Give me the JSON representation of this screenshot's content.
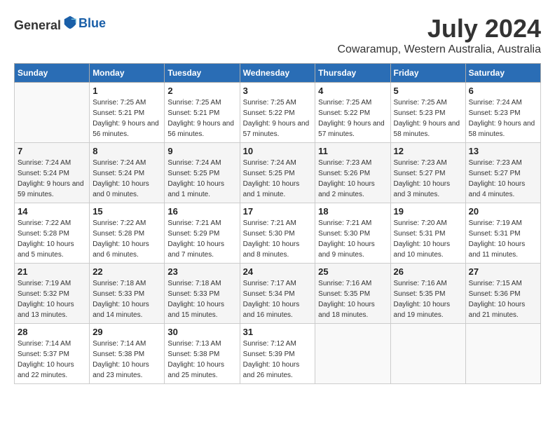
{
  "header": {
    "logo_general": "General",
    "logo_blue": "Blue",
    "month_title": "July 2024",
    "location": "Cowaramup, Western Australia, Australia"
  },
  "calendar": {
    "days_of_week": [
      "Sunday",
      "Monday",
      "Tuesday",
      "Wednesday",
      "Thursday",
      "Friday",
      "Saturday"
    ],
    "weeks": [
      [
        {
          "day": "",
          "sunrise": "",
          "sunset": "",
          "daylight": ""
        },
        {
          "day": "1",
          "sunrise": "Sunrise: 7:25 AM",
          "sunset": "Sunset: 5:21 PM",
          "daylight": "Daylight: 9 hours and 56 minutes."
        },
        {
          "day": "2",
          "sunrise": "Sunrise: 7:25 AM",
          "sunset": "Sunset: 5:21 PM",
          "daylight": "Daylight: 9 hours and 56 minutes."
        },
        {
          "day": "3",
          "sunrise": "Sunrise: 7:25 AM",
          "sunset": "Sunset: 5:22 PM",
          "daylight": "Daylight: 9 hours and 57 minutes."
        },
        {
          "day": "4",
          "sunrise": "Sunrise: 7:25 AM",
          "sunset": "Sunset: 5:22 PM",
          "daylight": "Daylight: 9 hours and 57 minutes."
        },
        {
          "day": "5",
          "sunrise": "Sunrise: 7:25 AM",
          "sunset": "Sunset: 5:23 PM",
          "daylight": "Daylight: 9 hours and 58 minutes."
        },
        {
          "day": "6",
          "sunrise": "Sunrise: 7:24 AM",
          "sunset": "Sunset: 5:23 PM",
          "daylight": "Daylight: 9 hours and 58 minutes."
        }
      ],
      [
        {
          "day": "7",
          "sunrise": "Sunrise: 7:24 AM",
          "sunset": "Sunset: 5:24 PM",
          "daylight": "Daylight: 9 hours and 59 minutes."
        },
        {
          "day": "8",
          "sunrise": "Sunrise: 7:24 AM",
          "sunset": "Sunset: 5:24 PM",
          "daylight": "Daylight: 10 hours and 0 minutes."
        },
        {
          "day": "9",
          "sunrise": "Sunrise: 7:24 AM",
          "sunset": "Sunset: 5:25 PM",
          "daylight": "Daylight: 10 hours and 1 minute."
        },
        {
          "day": "10",
          "sunrise": "Sunrise: 7:24 AM",
          "sunset": "Sunset: 5:25 PM",
          "daylight": "Daylight: 10 hours and 1 minute."
        },
        {
          "day": "11",
          "sunrise": "Sunrise: 7:23 AM",
          "sunset": "Sunset: 5:26 PM",
          "daylight": "Daylight: 10 hours and 2 minutes."
        },
        {
          "day": "12",
          "sunrise": "Sunrise: 7:23 AM",
          "sunset": "Sunset: 5:27 PM",
          "daylight": "Daylight: 10 hours and 3 minutes."
        },
        {
          "day": "13",
          "sunrise": "Sunrise: 7:23 AM",
          "sunset": "Sunset: 5:27 PM",
          "daylight": "Daylight: 10 hours and 4 minutes."
        }
      ],
      [
        {
          "day": "14",
          "sunrise": "Sunrise: 7:22 AM",
          "sunset": "Sunset: 5:28 PM",
          "daylight": "Daylight: 10 hours and 5 minutes."
        },
        {
          "day": "15",
          "sunrise": "Sunrise: 7:22 AM",
          "sunset": "Sunset: 5:28 PM",
          "daylight": "Daylight: 10 hours and 6 minutes."
        },
        {
          "day": "16",
          "sunrise": "Sunrise: 7:21 AM",
          "sunset": "Sunset: 5:29 PM",
          "daylight": "Daylight: 10 hours and 7 minutes."
        },
        {
          "day": "17",
          "sunrise": "Sunrise: 7:21 AM",
          "sunset": "Sunset: 5:30 PM",
          "daylight": "Daylight: 10 hours and 8 minutes."
        },
        {
          "day": "18",
          "sunrise": "Sunrise: 7:21 AM",
          "sunset": "Sunset: 5:30 PM",
          "daylight": "Daylight: 10 hours and 9 minutes."
        },
        {
          "day": "19",
          "sunrise": "Sunrise: 7:20 AM",
          "sunset": "Sunset: 5:31 PM",
          "daylight": "Daylight: 10 hours and 10 minutes."
        },
        {
          "day": "20",
          "sunrise": "Sunrise: 7:19 AM",
          "sunset": "Sunset: 5:31 PM",
          "daylight": "Daylight: 10 hours and 11 minutes."
        }
      ],
      [
        {
          "day": "21",
          "sunrise": "Sunrise: 7:19 AM",
          "sunset": "Sunset: 5:32 PM",
          "daylight": "Daylight: 10 hours and 13 minutes."
        },
        {
          "day": "22",
          "sunrise": "Sunrise: 7:18 AM",
          "sunset": "Sunset: 5:33 PM",
          "daylight": "Daylight: 10 hours and 14 minutes."
        },
        {
          "day": "23",
          "sunrise": "Sunrise: 7:18 AM",
          "sunset": "Sunset: 5:33 PM",
          "daylight": "Daylight: 10 hours and 15 minutes."
        },
        {
          "day": "24",
          "sunrise": "Sunrise: 7:17 AM",
          "sunset": "Sunset: 5:34 PM",
          "daylight": "Daylight: 10 hours and 16 minutes."
        },
        {
          "day": "25",
          "sunrise": "Sunrise: 7:16 AM",
          "sunset": "Sunset: 5:35 PM",
          "daylight": "Daylight: 10 hours and 18 minutes."
        },
        {
          "day": "26",
          "sunrise": "Sunrise: 7:16 AM",
          "sunset": "Sunset: 5:35 PM",
          "daylight": "Daylight: 10 hours and 19 minutes."
        },
        {
          "day": "27",
          "sunrise": "Sunrise: 7:15 AM",
          "sunset": "Sunset: 5:36 PM",
          "daylight": "Daylight: 10 hours and 21 minutes."
        }
      ],
      [
        {
          "day": "28",
          "sunrise": "Sunrise: 7:14 AM",
          "sunset": "Sunset: 5:37 PM",
          "daylight": "Daylight: 10 hours and 22 minutes."
        },
        {
          "day": "29",
          "sunrise": "Sunrise: 7:14 AM",
          "sunset": "Sunset: 5:38 PM",
          "daylight": "Daylight: 10 hours and 23 minutes."
        },
        {
          "day": "30",
          "sunrise": "Sunrise: 7:13 AM",
          "sunset": "Sunset: 5:38 PM",
          "daylight": "Daylight: 10 hours and 25 minutes."
        },
        {
          "day": "31",
          "sunrise": "Sunrise: 7:12 AM",
          "sunset": "Sunset: 5:39 PM",
          "daylight": "Daylight: 10 hours and 26 minutes."
        },
        {
          "day": "",
          "sunrise": "",
          "sunset": "",
          "daylight": ""
        },
        {
          "day": "",
          "sunrise": "",
          "sunset": "",
          "daylight": ""
        },
        {
          "day": "",
          "sunrise": "",
          "sunset": "",
          "daylight": ""
        }
      ]
    ]
  }
}
